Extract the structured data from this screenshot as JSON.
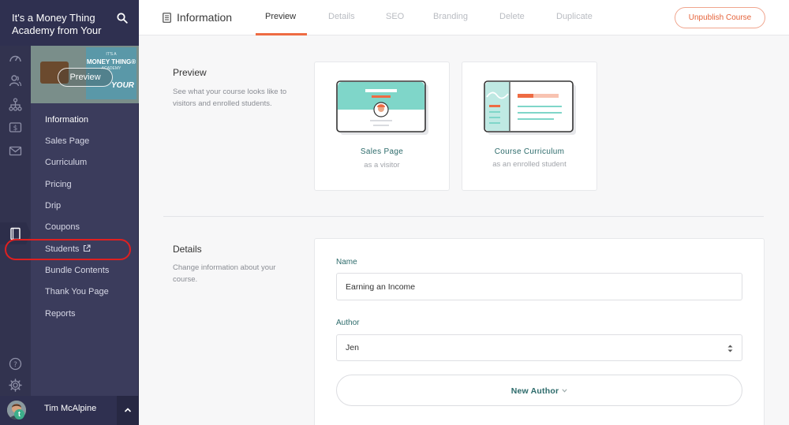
{
  "sidebar": {
    "school_name": "It's a Money Thing Academy from Your",
    "thumbnail": {
      "small_text": "IT'S A",
      "logo_text": "MONEY THING®",
      "sub_text": "ACADEMY",
      "your_text": "YOUR",
      "preview_label": "Preview"
    },
    "rail_icons": [
      "dashboard-icon",
      "users-icon",
      "sitemap-icon",
      "dollar-icon",
      "mail-icon",
      "book-icon",
      "help-icon",
      "gear-icon"
    ],
    "nav_items": [
      {
        "label": "Information",
        "active": true
      },
      {
        "label": "Sales Page"
      },
      {
        "label": "Curriculum"
      },
      {
        "label": "Pricing"
      },
      {
        "label": "Drip"
      },
      {
        "label": "Coupons"
      },
      {
        "label": "Students",
        "external": true
      },
      {
        "label": "Bundle Contents"
      },
      {
        "label": "Thank You Page"
      },
      {
        "label": "Reports"
      }
    ],
    "user": {
      "name": "Tim McAlpine",
      "badge": "t"
    }
  },
  "header": {
    "title": "Information",
    "tabs": [
      {
        "label": "Preview",
        "active": true
      },
      {
        "label": "Details"
      },
      {
        "label": "SEO"
      },
      {
        "label": "Branding"
      },
      {
        "label": "Delete"
      },
      {
        "label": "Duplicate"
      }
    ],
    "unpublish_label": "Unpublish Course"
  },
  "preview_section": {
    "title": "Preview",
    "description": "See what your course looks like to visitors and enrolled students.",
    "cards": [
      {
        "title": "Sales Page",
        "subtitle": "as a visitor"
      },
      {
        "title": "Course Curriculum",
        "subtitle": "as an enrolled student"
      }
    ]
  },
  "details_section": {
    "title": "Details",
    "description": "Change information about your course.",
    "name_label": "Name",
    "name_value": "Earning an Income",
    "author_label": "Author",
    "author_value": "Jen",
    "new_author_label": "New Author"
  },
  "colors": {
    "sidebar": "#3b3c5c",
    "accent": "#ee6b43",
    "teal": "#2d6b6b",
    "highlight_ring": "#e02020"
  }
}
